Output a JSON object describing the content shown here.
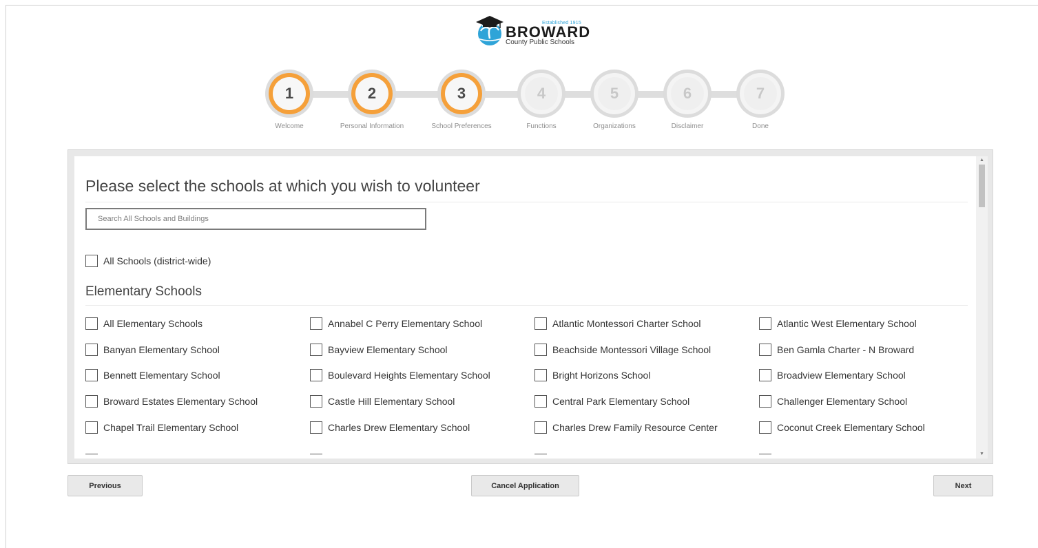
{
  "logo": {
    "established": "Established 1915",
    "name": "BROWARD",
    "subtitle": "County Public Schools"
  },
  "steps": [
    {
      "number": "1",
      "label": "Welcome",
      "active": true
    },
    {
      "number": "2",
      "label": "Personal Information",
      "active": true
    },
    {
      "number": "3",
      "label": "School Preferences",
      "active": true
    },
    {
      "number": "4",
      "label": "Functions",
      "active": false
    },
    {
      "number": "5",
      "label": "Organizations",
      "active": false
    },
    {
      "number": "6",
      "label": "Disclaimer",
      "active": false
    },
    {
      "number": "7",
      "label": "Done",
      "active": false
    }
  ],
  "colors": {
    "active_step": "#f5a03a",
    "inactive_step": "#efefef"
  },
  "main": {
    "title": "Please select the schools at which you wish to volunteer",
    "search_placeholder": "Search All Schools and Buildings",
    "all_schools_label": "All Schools (district-wide)",
    "section_title": "Elementary Schools",
    "schools": [
      "All Elementary Schools",
      "Annabel C Perry Elementary School",
      "Atlantic Montessori Charter School",
      "Atlantic West Elementary School",
      "Banyan Elementary School",
      "Bayview Elementary School",
      "Beachside Montessori Village School",
      "Ben Gamla Charter - N Broward",
      "Bennett Elementary School",
      "Boulevard Heights Elementary School",
      "Bright Horizons School",
      "Broadview Elementary School",
      "Broward Estates Elementary School",
      "Castle Hill Elementary School",
      "Central Park Elementary School",
      "Challenger Elementary School",
      "Chapel Trail Elementary School",
      "Charles Drew Elementary School",
      "Charles Drew Family Resource Center",
      "Coconut Creek Elementary School"
    ]
  },
  "buttons": {
    "previous": "Previous",
    "cancel": "Cancel Application",
    "next": "Next"
  }
}
